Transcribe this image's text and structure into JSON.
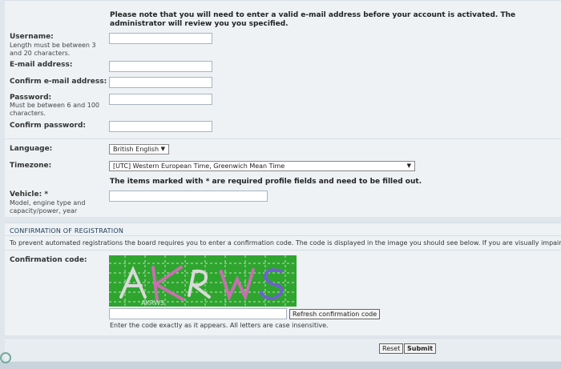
{
  "registration": {
    "notice": "Please note that you will need to enter a valid e-mail address before your account is activated. The administrator will review you you specified.",
    "username_label": "Username:",
    "username_hint": "Length must be between 3 and 20 characters.",
    "email_label": "E-mail address:",
    "confirm_email_label": "Confirm e-mail address:",
    "password_label": "Password:",
    "password_hint": "Must be between 6 and 100 characters.",
    "confirm_password_label": "Confirm password:",
    "language_label": "Language:",
    "language_value": "British English",
    "timezone_label": "Timezone:",
    "timezone_value": "[UTC] Western European Time, Greenwich Mean Time",
    "required_note": "The items marked with * are required profile fields and need to be filled out.",
    "vehicle_label": "Vehicle: *",
    "vehicle_hint": "Model, engine type and capacity/power, year"
  },
  "confirmation": {
    "title": "CONFIRMATION OF REGISTRATION",
    "intro": "To prevent automated registrations the board requires you to enter a confirmation code. The code is displayed in the image you should see below. If you are visually impaired or c",
    "code_label": "Confirmation code:",
    "refresh_button": "Refresh confirmation code",
    "code_hint": "Enter the code exactly as it appears. All letters are case insensitive.",
    "captcha_text": "AKRWS"
  },
  "actions": {
    "reset_button": "Reset",
    "submit_button": "Submit"
  },
  "colors": {
    "captcha_bg": "#2fa52f",
    "panel_bg": "#eef2f5"
  }
}
